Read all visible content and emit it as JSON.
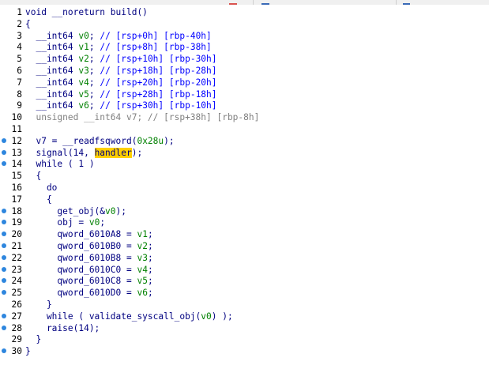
{
  "window": {
    "tabs": [
      {
        "label": "",
        "accent": "#d9534f"
      },
      {
        "label": "",
        "accent": "#3a6ab7"
      },
      {
        "label": "",
        "accent": "#3a6ab7"
      }
    ]
  },
  "colors": {
    "code_text": "#000080",
    "var_green": "#008000",
    "number_green": "#008000",
    "comment_blue": "#0000ff",
    "highlight": "#ffd000",
    "breakpoint_dot": "#2e86de",
    "line_number": "#000000",
    "background": "#ffffff"
  },
  "code": {
    "lines": [
      {
        "n": "1",
        "dot": false,
        "tokens": [
          {
            "t": "void __noreturn build()",
            "c": "#000080"
          }
        ]
      },
      {
        "n": "2",
        "dot": false,
        "tokens": [
          {
            "t": "{",
            "c": "#000080"
          }
        ]
      },
      {
        "n": "3",
        "dot": false,
        "tokens": [
          {
            "t": "  __int64 ",
            "c": "#000080"
          },
          {
            "t": "v0",
            "c": "#008000"
          },
          {
            "t": "; ",
            "c": "#000080"
          },
          {
            "t": "// [rsp+0h] [rbp-40h]",
            "c": "#0000ff"
          }
        ]
      },
      {
        "n": "4",
        "dot": false,
        "tokens": [
          {
            "t": "  __int64 ",
            "c": "#000080"
          },
          {
            "t": "v1",
            "c": "#008000"
          },
          {
            "t": "; ",
            "c": "#000080"
          },
          {
            "t": "// [rsp+8h] [rbp-38h]",
            "c": "#0000ff"
          }
        ]
      },
      {
        "n": "5",
        "dot": false,
        "tokens": [
          {
            "t": "  __int64 ",
            "c": "#000080"
          },
          {
            "t": "v2",
            "c": "#008000"
          },
          {
            "t": "; ",
            "c": "#000080"
          },
          {
            "t": "// [rsp+10h] [rbp-30h]",
            "c": "#0000ff"
          }
        ]
      },
      {
        "n": "6",
        "dot": false,
        "tokens": [
          {
            "t": "  __int64 ",
            "c": "#000080"
          },
          {
            "t": "v3",
            "c": "#008000"
          },
          {
            "t": "; ",
            "c": "#000080"
          },
          {
            "t": "// [rsp+18h] [rbp-28h]",
            "c": "#0000ff"
          }
        ]
      },
      {
        "n": "7",
        "dot": false,
        "tokens": [
          {
            "t": "  __int64 ",
            "c": "#000080"
          },
          {
            "t": "v4",
            "c": "#008000"
          },
          {
            "t": "; ",
            "c": "#000080"
          },
          {
            "t": "// [rsp+20h] [rbp-20h]",
            "c": "#0000ff"
          }
        ]
      },
      {
        "n": "8",
        "dot": false,
        "tokens": [
          {
            "t": "  __int64 ",
            "c": "#000080"
          },
          {
            "t": "v5",
            "c": "#008000"
          },
          {
            "t": "; ",
            "c": "#000080"
          },
          {
            "t": "// [rsp+28h] [rbp-18h]",
            "c": "#0000ff"
          }
        ]
      },
      {
        "n": "9",
        "dot": false,
        "tokens": [
          {
            "t": "  __int64 ",
            "c": "#000080"
          },
          {
            "t": "v6",
            "c": "#008000"
          },
          {
            "t": "; ",
            "c": "#000080"
          },
          {
            "t": "// [rsp+30h] [rbp-10h]",
            "c": "#0000ff"
          }
        ]
      },
      {
        "n": "10",
        "dot": false,
        "tokens": [
          {
            "t": "  unsigned __int64 v7; // [rsp+38h] [rbp-8h]",
            "c": "#808080"
          }
        ]
      },
      {
        "n": "11",
        "dot": false,
        "tokens": [
          {
            "t": "",
            "c": "#000080"
          }
        ]
      },
      {
        "n": "12",
        "dot": true,
        "tokens": [
          {
            "t": "  v7 = __readfsqword(",
            "c": "#000080"
          },
          {
            "t": "0x28u",
            "c": "#008000"
          },
          {
            "t": ");",
            "c": "#000080"
          }
        ]
      },
      {
        "n": "13",
        "dot": true,
        "tokens": [
          {
            "t": "  signal(14, ",
            "c": "#000080"
          },
          {
            "t": "handler",
            "c": "#000080",
            "hl": true
          },
          {
            "t": ");",
            "c": "#000080"
          }
        ]
      },
      {
        "n": "14",
        "dot": true,
        "tokens": [
          {
            "t": "  while ( 1 )",
            "c": "#000080"
          }
        ]
      },
      {
        "n": "15",
        "dot": false,
        "tokens": [
          {
            "t": "  {",
            "c": "#000080"
          }
        ]
      },
      {
        "n": "16",
        "dot": false,
        "tokens": [
          {
            "t": "    do",
            "c": "#000080"
          }
        ]
      },
      {
        "n": "17",
        "dot": false,
        "tokens": [
          {
            "t": "    {",
            "c": "#000080"
          }
        ]
      },
      {
        "n": "18",
        "dot": true,
        "tokens": [
          {
            "t": "      get_obj(&",
            "c": "#000080"
          },
          {
            "t": "v0",
            "c": "#008000"
          },
          {
            "t": ");",
            "c": "#000080"
          }
        ]
      },
      {
        "n": "19",
        "dot": true,
        "tokens": [
          {
            "t": "      obj = ",
            "c": "#000080"
          },
          {
            "t": "v0",
            "c": "#008000"
          },
          {
            "t": ";",
            "c": "#000080"
          }
        ]
      },
      {
        "n": "20",
        "dot": true,
        "tokens": [
          {
            "t": "      qword_6010A8 = ",
            "c": "#000080"
          },
          {
            "t": "v1",
            "c": "#008000"
          },
          {
            "t": ";",
            "c": "#000080"
          }
        ]
      },
      {
        "n": "21",
        "dot": true,
        "tokens": [
          {
            "t": "      qword_6010B0 = ",
            "c": "#000080"
          },
          {
            "t": "v2",
            "c": "#008000"
          },
          {
            "t": ";",
            "c": "#000080"
          }
        ]
      },
      {
        "n": "22",
        "dot": true,
        "tokens": [
          {
            "t": "      qword_6010B8 = ",
            "c": "#000080"
          },
          {
            "t": "v3",
            "c": "#008000"
          },
          {
            "t": ";",
            "c": "#000080"
          }
        ]
      },
      {
        "n": "23",
        "dot": true,
        "tokens": [
          {
            "t": "      qword_6010C0 = ",
            "c": "#000080"
          },
          {
            "t": "v4",
            "c": "#008000"
          },
          {
            "t": ";",
            "c": "#000080"
          }
        ]
      },
      {
        "n": "24",
        "dot": true,
        "tokens": [
          {
            "t": "      qword_6010C8 = ",
            "c": "#000080"
          },
          {
            "t": "v5",
            "c": "#008000"
          },
          {
            "t": ";",
            "c": "#000080"
          }
        ]
      },
      {
        "n": "25",
        "dot": true,
        "tokens": [
          {
            "t": "      qword_6010D0 = ",
            "c": "#000080"
          },
          {
            "t": "v6",
            "c": "#008000"
          },
          {
            "t": ";",
            "c": "#000080"
          }
        ]
      },
      {
        "n": "26",
        "dot": false,
        "tokens": [
          {
            "t": "    }",
            "c": "#000080"
          }
        ]
      },
      {
        "n": "27",
        "dot": true,
        "tokens": [
          {
            "t": "    while ( validate_syscall_obj(",
            "c": "#000080"
          },
          {
            "t": "v0",
            "c": "#008000"
          },
          {
            "t": ") );",
            "c": "#000080"
          }
        ]
      },
      {
        "n": "28",
        "dot": true,
        "tokens": [
          {
            "t": "    raise(14);",
            "c": "#000080"
          }
        ]
      },
      {
        "n": "29",
        "dot": false,
        "tokens": [
          {
            "t": "  }",
            "c": "#000080"
          }
        ]
      },
      {
        "n": "30",
        "dot": true,
        "tokens": [
          {
            "t": "}",
            "c": "#000080"
          }
        ]
      }
    ]
  }
}
